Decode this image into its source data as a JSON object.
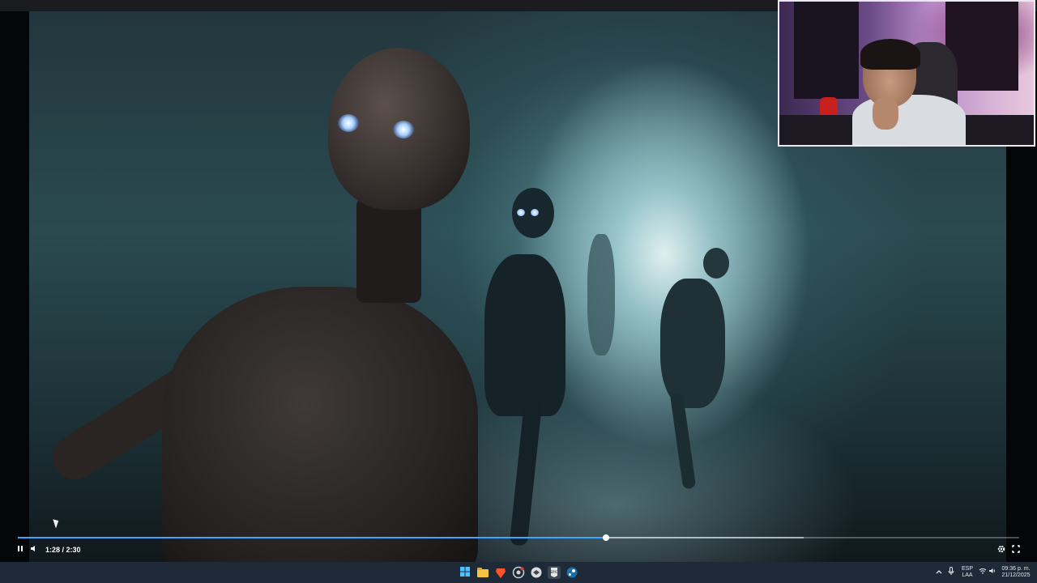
{
  "player": {
    "time_display": "1:28 / 2:30",
    "progress_fraction": 0.587,
    "buffered_fraction": 0.785,
    "play_pause_icon": "pause-icon",
    "volume_icon": "volume-icon",
    "settings_icon": "gear-icon",
    "fullscreen_icon": "fullscreen-icon"
  },
  "webcam": {
    "label": "webcam-overlay"
  },
  "taskbar": {
    "icons": [
      "windows-start-icon",
      "file-explorer-icon",
      "brave-browser-icon",
      "chrome-icon",
      "app-icon",
      "epic-games-icon",
      "steam-icon"
    ],
    "tray": {
      "chevron_icon": "chevron-up-icon",
      "mic_icon": "microphone-icon",
      "language_top": "ESP",
      "language_bottom": "LAA",
      "wifi_icon": "wifi-icon",
      "speaker_icon": "speaker-icon",
      "time": "09:36 p. m.",
      "date": "21/12/2025"
    }
  },
  "colors": {
    "seek_fill": "#3ea6ff",
    "taskbar_bg": "#1f2a38"
  }
}
